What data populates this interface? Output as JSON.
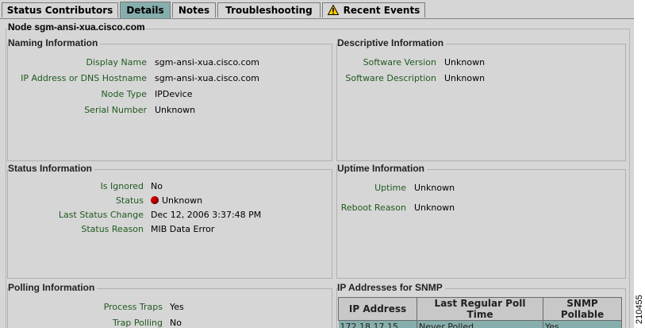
{
  "tabs": [
    {
      "label": "Status Contributors",
      "active": false
    },
    {
      "label": "Details",
      "active": true
    },
    {
      "label": "Notes",
      "active": false
    },
    {
      "label": "Troubleshooting",
      "active": false
    },
    {
      "label": "Recent Events",
      "active": false,
      "icon": "warning-icon"
    }
  ],
  "node": {
    "prefix": "Node",
    "name": "sgm-ansi-xua.cisco.com"
  },
  "naming": {
    "title": "Naming Information",
    "fields": [
      {
        "label": "Display Name",
        "value": "sgm-ansi-xua.cisco.com"
      },
      {
        "label": "IP Address or DNS Hostname",
        "value": "sgm-ansi-xua.cisco.com"
      },
      {
        "label": "Node Type",
        "value": "IPDevice"
      },
      {
        "label": "Serial Number",
        "value": "Unknown"
      }
    ]
  },
  "descriptive": {
    "title": "Descriptive Information",
    "fields": [
      {
        "label": "Software Version",
        "value": "Unknown"
      },
      {
        "label": "Software Description",
        "value": "Unknown"
      }
    ]
  },
  "status": {
    "title": "Status Information",
    "fields": [
      {
        "label": "Is Ignored",
        "value": "No"
      },
      {
        "label": "Status",
        "value": "Unknown"
      },
      {
        "label": "Last Status Change",
        "value": "Dec 12, 2006 3:37:48 PM"
      },
      {
        "label": "Status Reason",
        "value": "MIB Data Error"
      }
    ],
    "status_color": "#cc0000"
  },
  "uptime": {
    "title": "Uptime Information",
    "fields": [
      {
        "label": "Uptime",
        "value": "Unknown"
      },
      {
        "label": "Reboot Reason",
        "value": "Unknown"
      }
    ]
  },
  "polling": {
    "title": "Polling Information",
    "fields": [
      {
        "label": "Process Traps",
        "value": "Yes"
      },
      {
        "label": "Trap Polling",
        "value": "No"
      }
    ]
  },
  "snmp": {
    "title": "IP Addresses for SNMP",
    "columns": [
      "IP Address",
      "Last Regular Poll Time",
      "SNMP Pollable"
    ],
    "rows": [
      [
        "172.18.17.15",
        "Never Polled",
        "Yes"
      ]
    ]
  },
  "figure_number": "210455",
  "colors": {
    "active_tab": "#86aeac",
    "panel_bg": "#d6d6d6",
    "label_text": "#1f5a1f",
    "selected_row": "#86aeac"
  }
}
